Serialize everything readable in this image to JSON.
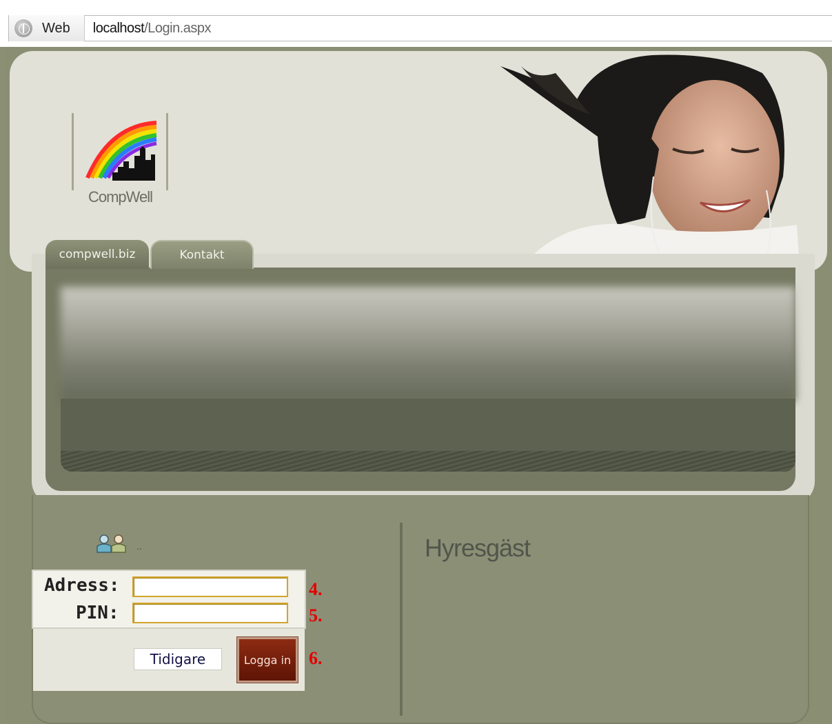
{
  "browser": {
    "mode_label": "Web",
    "url_host": "localhost",
    "url_path": "/Login.aspx"
  },
  "logo": {
    "text": "CompWell"
  },
  "tabs": [
    {
      "label": "compwell.biz"
    },
    {
      "label": "Kontakt"
    }
  ],
  "login": {
    "dots": "..",
    "address_label": "Adress:",
    "pin_label": "PIN:",
    "address_value": "",
    "pin_value": "",
    "previous_button": "Tidigare",
    "login_button": "Logga in",
    "markers": [
      "4.",
      "5.",
      "6."
    ]
  },
  "right_panel": {
    "title": "Hyresgäst"
  },
  "colors": {
    "frame": "#8a8e73",
    "header": "#e1e1d7",
    "accent_button": "#7a200b",
    "field_border": "#d1a52a",
    "marker": "#e40000"
  },
  "icons": [
    "globe-icon",
    "users-icon"
  ]
}
